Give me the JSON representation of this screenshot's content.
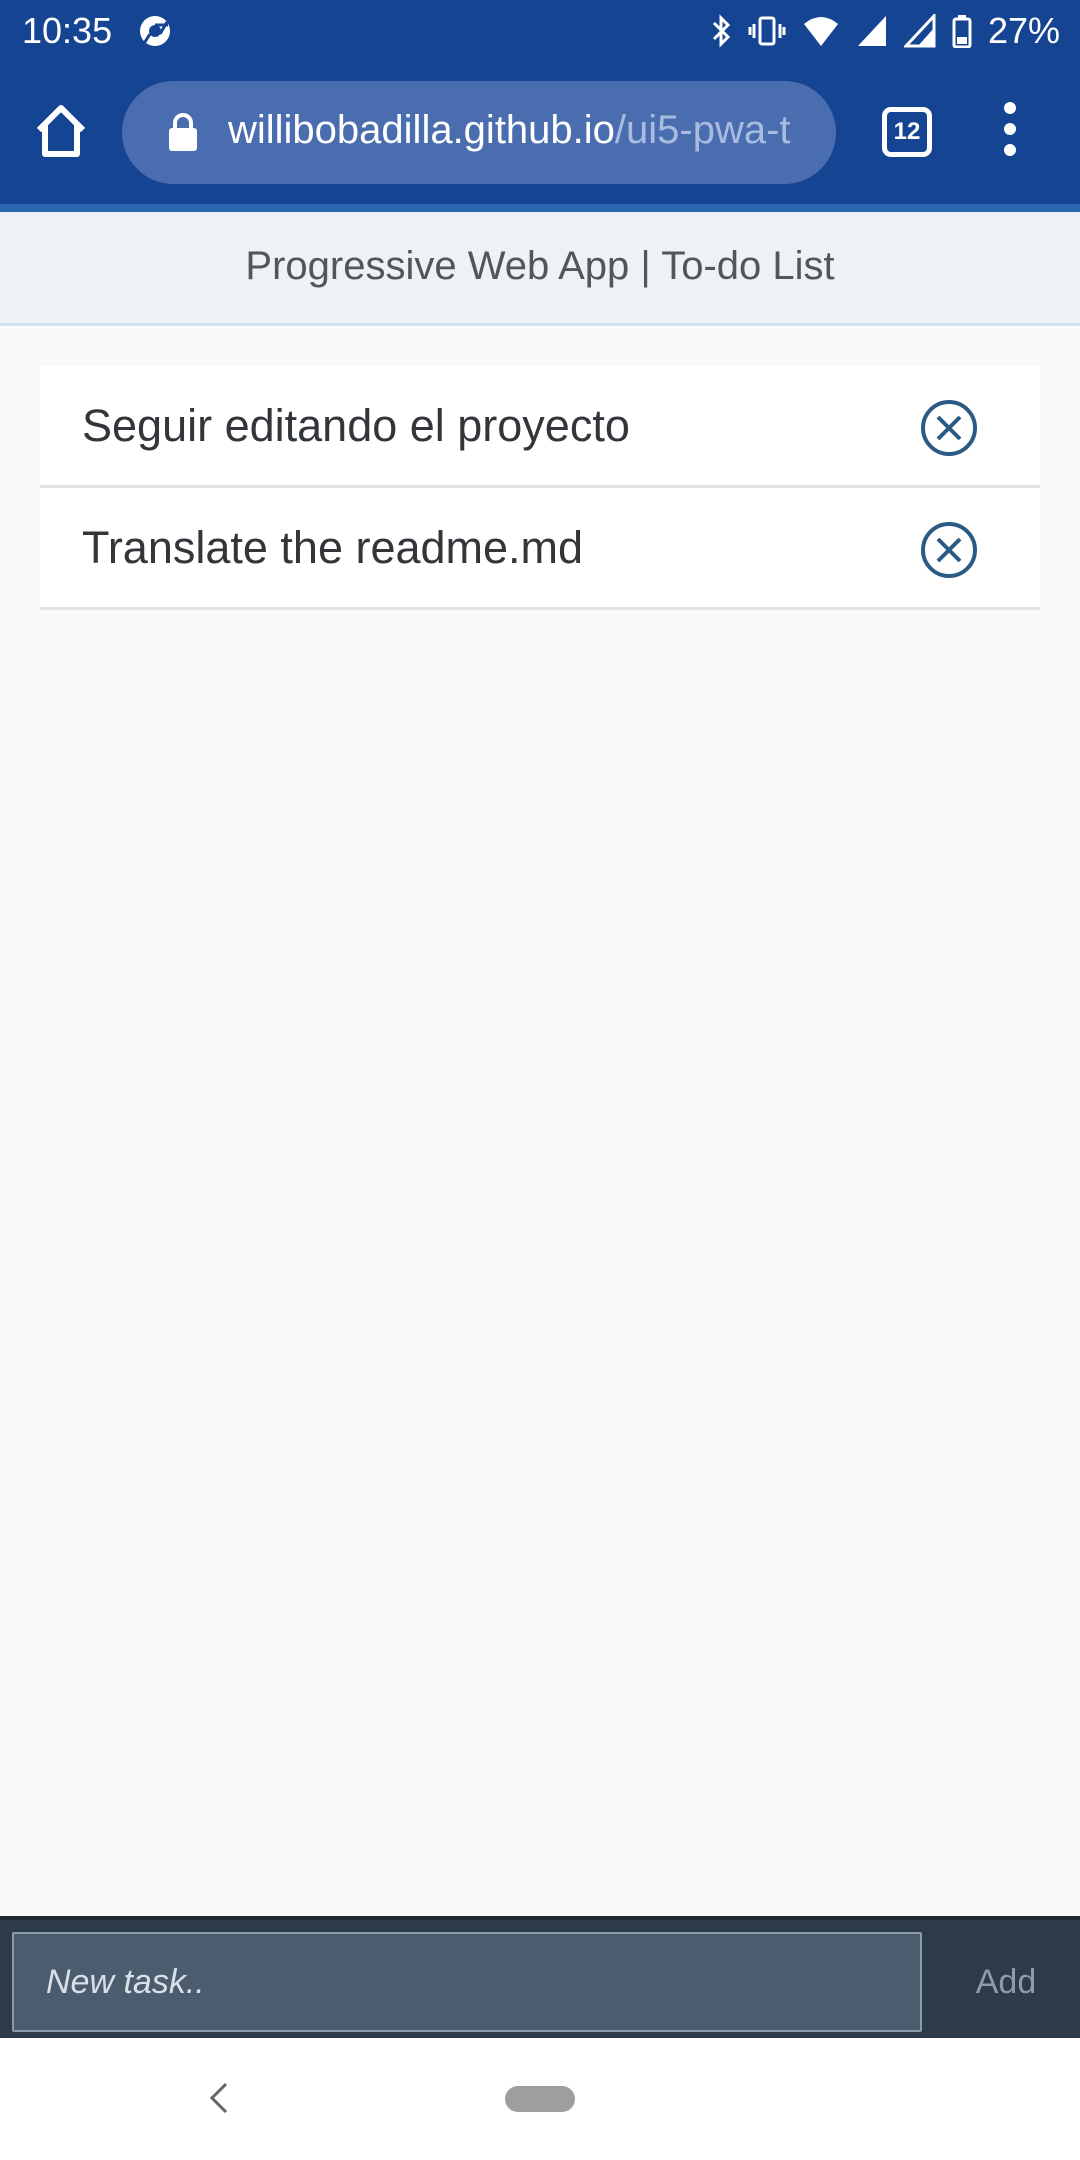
{
  "status_bar": {
    "time": "10:35",
    "battery_percent": "27%",
    "icons": [
      "chrome-icon",
      "bluetooth-icon",
      "vibrate-icon",
      "wifi-icon",
      "signal-icon",
      "signal-icon-2",
      "battery-icon"
    ]
  },
  "browser": {
    "url_host": "willibobadilla.github.io",
    "url_path": "/ui5-pwa-t",
    "tab_count": "12"
  },
  "app": {
    "title": "Progressive Web App | To-do List"
  },
  "tasks": [
    {
      "label": "Seguir editando el proyecto"
    },
    {
      "label": "Translate the readme.md"
    }
  ],
  "footer": {
    "placeholder": "New task..",
    "add_label": "Add"
  },
  "colors": {
    "toolbar": "#154493",
    "accent_icon": "#2b5b84",
    "footer": "#2d3a48"
  }
}
